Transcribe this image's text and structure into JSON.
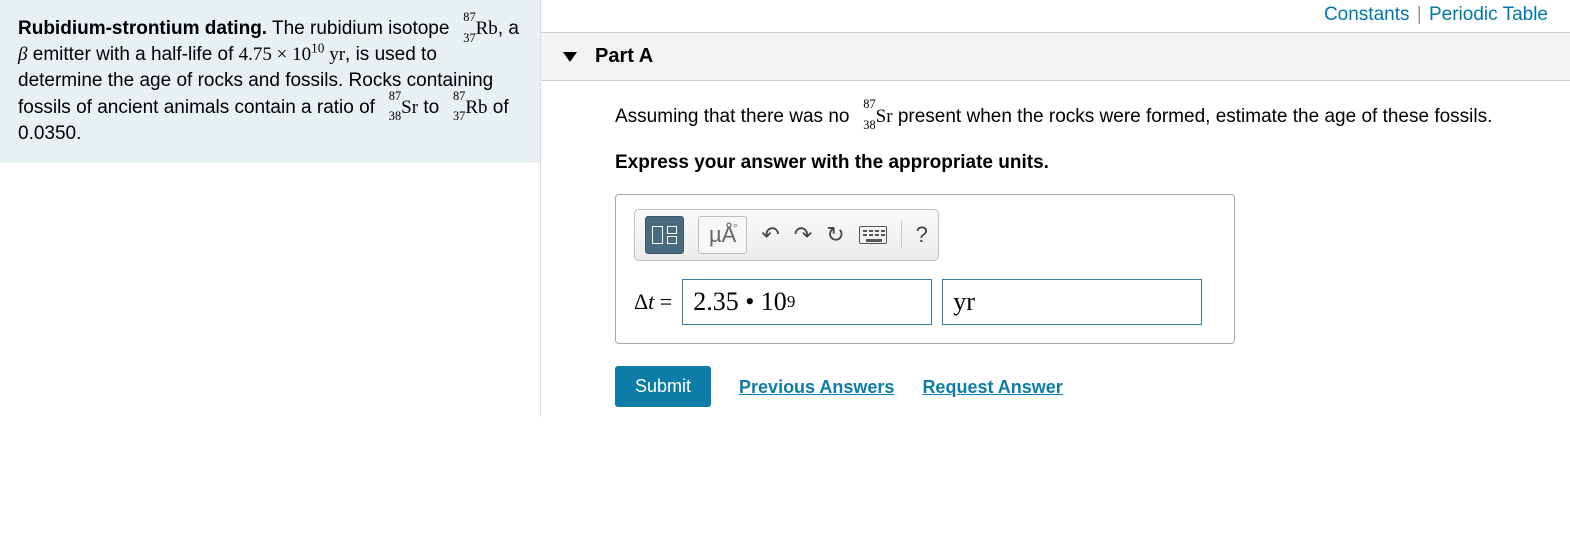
{
  "header_links": {
    "constants": "Constants",
    "periodic": "Periodic Table"
  },
  "problem": {
    "title": "Rubidium-strontium dating.",
    "p1a": " The rubidium isotope ",
    "rb": {
      "mass": "87",
      "num": "37",
      "sym": "Rb"
    },
    "p1b": ", a ",
    "beta": "β",
    "p1c": " emitter with a half-life of ",
    "half_life_val": "4.75 × 10",
    "half_life_exp": "10",
    "half_life_unit": " yr",
    "p2a": ", is used to determine the age of rocks and fossils. Rocks containing fossils of ancient animals contain a ratio of ",
    "sr": {
      "mass": "87",
      "num": "38",
      "sym": "Sr"
    },
    "p2b": " to ",
    "p2c": " of ",
    "ratio": "0.0350."
  },
  "part": {
    "label": "Part A",
    "q1a": "Assuming that there was no ",
    "q1b": " present when the rocks were formed, estimate the age of these fossils.",
    "instruction": "Express your answer with the appropriate units."
  },
  "toolbar": {
    "units": "µÅ",
    "help": "?"
  },
  "answer": {
    "lhs_delta": "Δ",
    "lhs_t": "t",
    "eq": " = ",
    "value_a": "2.35 • 10",
    "value_exp": "9",
    "unit": "yr"
  },
  "actions": {
    "submit": "Submit",
    "prev": "Previous Answers",
    "req": "Request Answer"
  }
}
